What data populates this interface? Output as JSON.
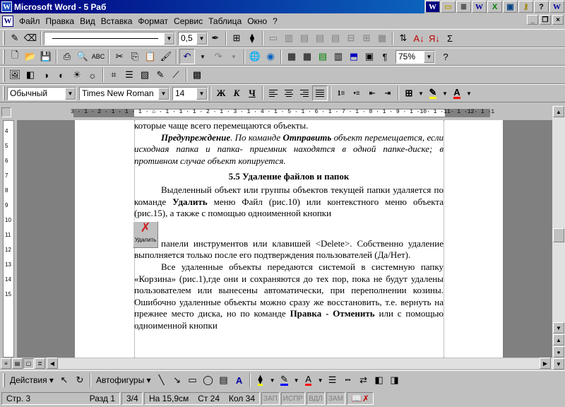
{
  "title": "Microsoft Word - 5 Раб",
  "app_icon": "W",
  "taskbar_icons": [
    "word-icon",
    "folder-icon",
    "notes-icon",
    "word-icon",
    "excel-icon",
    "app-icon",
    "key-icon",
    "question-icon",
    "word-icon"
  ],
  "window_controls": {
    "minimize": "_",
    "restore": "❐",
    "close": "×"
  },
  "menu": [
    "Файл",
    "Правка",
    "Вид",
    "Вставка",
    "Формат",
    "Сервис",
    "Таблица",
    "Окно",
    "?"
  ],
  "drawing_toolbar_top": {
    "line_width": "0,5"
  },
  "standard_toolbar": {
    "zoom": "75%",
    "para_mark": "¶"
  },
  "formatting": {
    "style": "Обычный",
    "font": "Times New Roman",
    "size": "14",
    "bold": "Ж",
    "italic": "К",
    "underline": "Ч",
    "font_color": "#ff0000",
    "highlight_color": "#ffff00"
  },
  "ruler_text": "3 · 1 · 2 · 1 · 1 · 1 · ⌂ · 1 · 1 · 1 · 2 · 1 · 3 · 1 · 4 · 1 · 5 · 1 · 6 · 1 · 7 · 1 · 8 · 1 · 9 · 1 ·10· 1 ·11· 1 ·12· 1 ·13· 1 ·14· 1 ·15· ⌂ ·16· 1 ·17· 1",
  "vruler_numbers": [
    "4",
    "5",
    "6",
    "7",
    "8",
    "9",
    "10",
    "11",
    "12",
    "13",
    "14",
    "15"
  ],
  "document": {
    "line1": "которые чаще всего перемещаются объекты.",
    "warning_label": "Предупреждение",
    "warning_mid": ". По команде ",
    "warning_cmd": "Отправить",
    "warning_rest": " объект перемещается, если исходная папка и папка- приемник находятся в одной папке-диске; в противном случае объект копируется.",
    "heading": "5.5 Удаление файлов и  папок",
    "p1_start": "Выделенный объект или группы объектов текущей папки удаляется по команде ",
    "p1_cmd": "Удалить",
    "p1_rest": " меню Файл (рис.10) или контекстного меню объекта (рис.15), а также с помощью одноименной кнопки",
    "delete_button_label": "Удалить",
    "p2": "панели инструментов или клавишей <Delete>. Собственно удаление выполняется только после его подтверждения пользователей (Да/Нет).",
    "p3_start": "Все удаленные объекты передаются системой в системную папку «Корзина» (рис.1),где они и сохраняются до тех пор, пока не будут удалены пользователем или вынесены автоматически, при переполнении козины. Ошибочно удаленные объекты можно сразу  же восстановить, т.е. вернуть на прежнее место диска, но по команде ",
    "p3_cmd": "Правка - Отменить",
    "p3_rest": " или с помощью одноименной кнопки"
  },
  "drawing_toolbar": {
    "actions": "Действия",
    "autoshapes": "Автофигуры"
  },
  "status": {
    "page": "Стр. 3",
    "section": "Разд 1",
    "pages": "3/4",
    "position": "На 15,9см",
    "line": "Ст 24",
    "col": "Кол 34",
    "rec": "ЗАП",
    "trk": "ИСПР",
    "ext": "ВДЛ",
    "ovr": "ЗАМ"
  }
}
